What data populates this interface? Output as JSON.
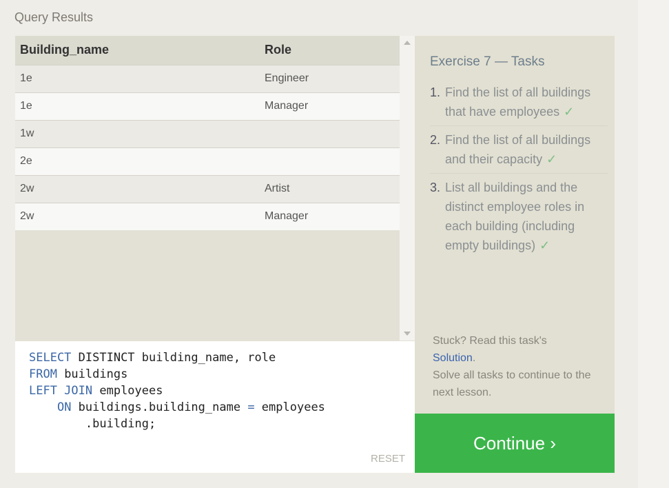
{
  "section_label": "Query Results",
  "results": {
    "columns": [
      "Building_name",
      "Role"
    ],
    "rows": [
      [
        "1e",
        "Engineer"
      ],
      [
        "1e",
        "Manager"
      ],
      [
        "1w",
        ""
      ],
      [
        "2e",
        ""
      ],
      [
        "2w",
        "Artist"
      ],
      [
        "2w",
        "Manager"
      ]
    ]
  },
  "editor": {
    "lines": [
      [
        {
          "kw": "SELECT"
        },
        {
          "t": " DISTINCT building_name, role"
        }
      ],
      [
        {
          "kw": "FROM"
        },
        {
          "t": " buildings"
        }
      ],
      [
        {
          "kw": "LEFT JOIN"
        },
        {
          "t": " employees"
        }
      ],
      [
        {
          "t": "    "
        },
        {
          "kw": "ON"
        },
        {
          "t": " buildings.building_name "
        },
        {
          "kw": "="
        },
        {
          "t": " employees"
        }
      ],
      [
        {
          "t": "        .building;"
        }
      ]
    ],
    "reset_label": "RESET"
  },
  "tasks": {
    "title": "Exercise 7 — Tasks",
    "items": [
      {
        "num": "1.",
        "text": "Find the list of all buildings that have employees",
        "check": "✓"
      },
      {
        "num": "2.",
        "text": "Find the list of all buildings and their capacity",
        "check": "✓"
      },
      {
        "num": "3.",
        "text": "List all buildings and the distinct employee roles in each building (including empty buildings)",
        "check": "✓"
      }
    ],
    "stuck_prefix": "Stuck? Read this task's",
    "solution_link": "Solution",
    "stuck_suffix": ".",
    "solve_all": "Solve all tasks to continue to the next lesson."
  },
  "continue_label": "Continue ›"
}
